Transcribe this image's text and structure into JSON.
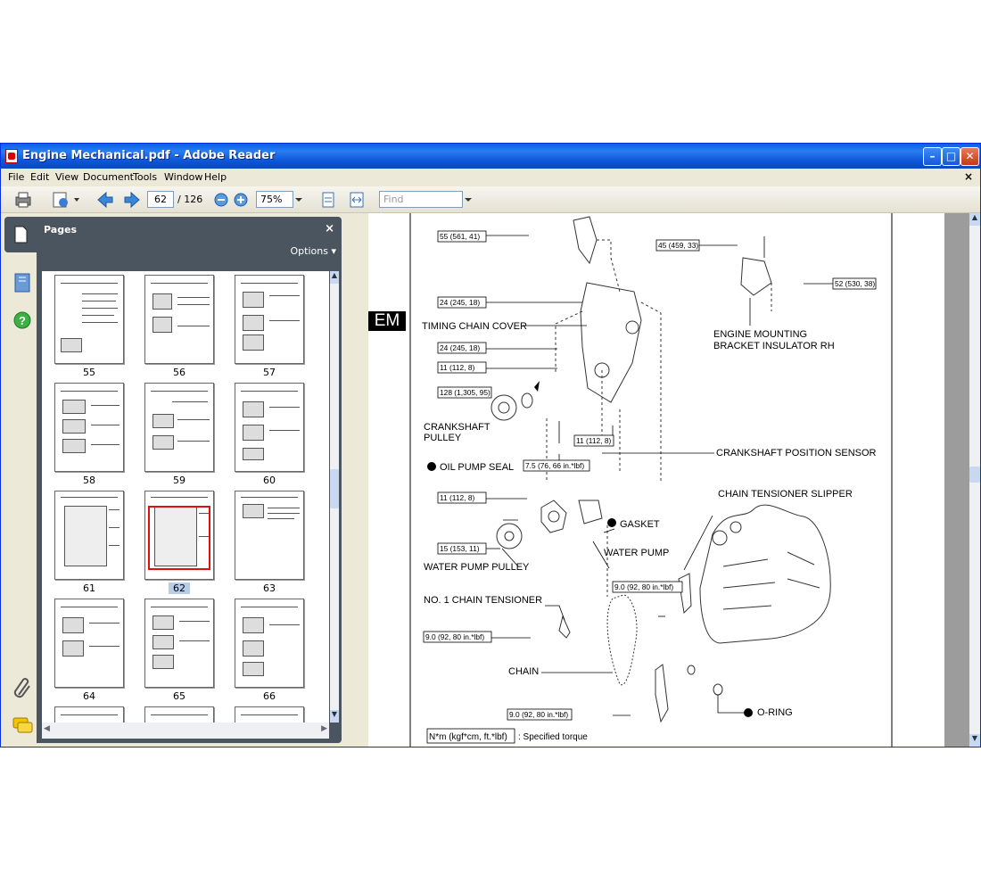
{
  "window": {
    "title": "Engine Mechanical.pdf - Adobe Reader"
  },
  "menu": [
    "File",
    "Edit",
    "View",
    "Document",
    "Tools",
    "Window",
    "Help"
  ],
  "toolbar": {
    "current_page": "62",
    "page_separator": "/",
    "total_pages": "126",
    "zoom": "75%",
    "find_placeholder": "Find"
  },
  "pages_panel": {
    "title": "Pages",
    "options_label": "Options",
    "thumbnails": [
      "55",
      "56",
      "57",
      "58",
      "59",
      "60",
      "61",
      "62",
      "63",
      "64",
      "65",
      "66"
    ],
    "selected": "62"
  },
  "document": {
    "section_tab": "EM",
    "torque_labels": [
      "55 (561, 41)",
      "45 (459, 33)",
      "52 (530, 38)",
      "24 (245, 18)",
      "24 (245, 18)",
      "11 (112, 8)",
      "128 (1,305, 95)",
      "11 (112, 8)",
      "7.5 (76, 66 in.*lbf)",
      "11 (112, 8)",
      "15 (153, 11)",
      "9.0 (92, 80 in.*lbf)",
      "9.0 (92, 80 in.*lbf)",
      "9.0 (92, 80 in.*lbf)"
    ],
    "part_labels": {
      "timing_chain_cover": "TIMING CHAIN COVER",
      "engine_mount_1": "ENGINE MOUNTING",
      "engine_mount_2": "BRACKET INSULATOR RH",
      "crank_pulley_1": "CRANKSHAFT",
      "crank_pulley_2": "PULLEY",
      "oil_pump_seal": "OIL PUMP SEAL",
      "crank_sensor": "CRANKSHAFT POSITION SENSOR",
      "tensioner_slipper": "CHAIN TENSIONER SLIPPER",
      "gasket": "GASKET",
      "water_pump": "WATER PUMP",
      "water_pump_pulley": "WATER PUMP PULLEY",
      "chain_tensioner": "NO. 1 CHAIN TENSIONER",
      "chain": "CHAIN",
      "o_ring": "O-RING",
      "legend_box": "N*m (kgf*cm, ft.*lbf)",
      "legend_text": ": Specified torque"
    }
  }
}
